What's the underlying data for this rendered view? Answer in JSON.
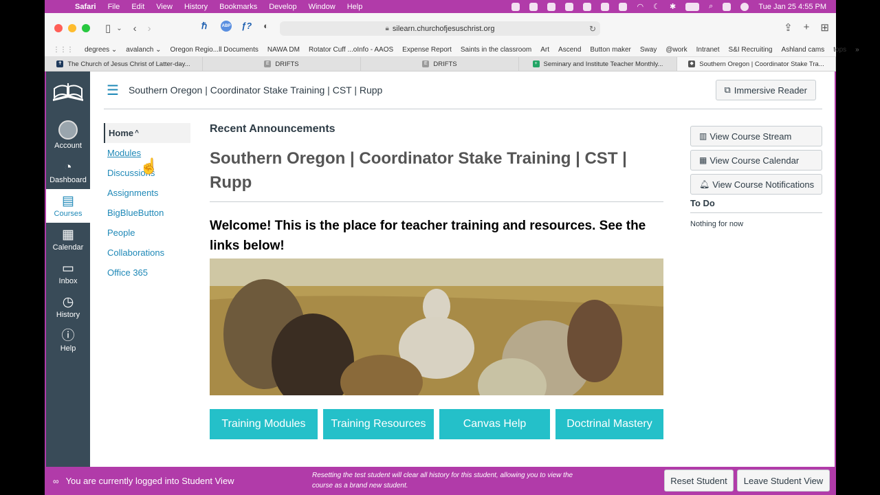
{
  "menubar": {
    "items": [
      "Safari",
      "File",
      "Edit",
      "View",
      "History",
      "Bookmarks",
      "Develop",
      "Window",
      "Help"
    ],
    "datetime": "Tue Jan 25  4:55 PM"
  },
  "browser": {
    "url": "silearn.churchofjesuschrist.org",
    "bookmarks": [
      "degrees ⌄",
      "avalanch ⌄",
      "Oregon Regio...ll Documents",
      "NAWA DM",
      "Rotator Cuff ...oInfo - AAOS",
      "Expense Report",
      "Saints in the classroom",
      "Art",
      "Ascend",
      "Button maker",
      "Sway",
      "@work",
      "Intranet",
      "S&I Recruiting",
      "Ashland cams",
      "tops"
    ],
    "tabs": [
      {
        "label": "The Church of Jesus Christ of Latter-day...",
        "fav": "✝",
        "color": "#1f3a5c"
      },
      {
        "label": "DRIFTS",
        "fav": "E",
        "color": "#9a9a9a"
      },
      {
        "label": "DRIFTS",
        "fav": "E",
        "color": "#9a9a9a"
      },
      {
        "label": "Seminary and Institute Teacher Monthly...",
        "fav": "+",
        "color": "#23a566"
      },
      {
        "label": "Southern Oregon | Coordinator Stake Tra...",
        "fav": "◆",
        "color": "#555"
      }
    ],
    "ext_labels": {
      "abp": "ABP",
      "f": "ƒ?"
    }
  },
  "global_nav": {
    "account": "Account",
    "dashboard": "Dashboard",
    "courses": "Courses",
    "calendar": "Calendar",
    "inbox": "Inbox",
    "history": "History",
    "help": "Help"
  },
  "header": {
    "breadcrumb": "Southern Oregon | Coordinator Stake Training | CST | Rupp",
    "immersive_reader": "Immersive Reader"
  },
  "course_nav": {
    "home": "Home",
    "items": [
      "Modules",
      "Discussions",
      "Assignments",
      "BigBlueButton",
      "People",
      "Collaborations",
      "Office 365"
    ]
  },
  "main": {
    "announcements": "Recent Announcements",
    "title": "Southern Oregon | Coordinator Stake Training | CST | Rupp",
    "welcome": "Welcome! This is the place for teacher training and resources. See the links below!",
    "buttons": [
      "Training Modules",
      "Training Resources",
      "Canvas Help",
      "Doctrinal Mastery"
    ]
  },
  "sidebar": {
    "stream": "View Course Stream",
    "calendar": "View Course Calendar",
    "notifications": "View Course Notifications",
    "todo": "To Do",
    "nothing": "Nothing for now"
  },
  "student_view": {
    "message": "You are currently logged into Student View",
    "note": "Resetting the test student will clear all history for this student, allowing you to view the course as a brand new student.",
    "reset": "Reset Student",
    "leave": "Leave Student View"
  }
}
